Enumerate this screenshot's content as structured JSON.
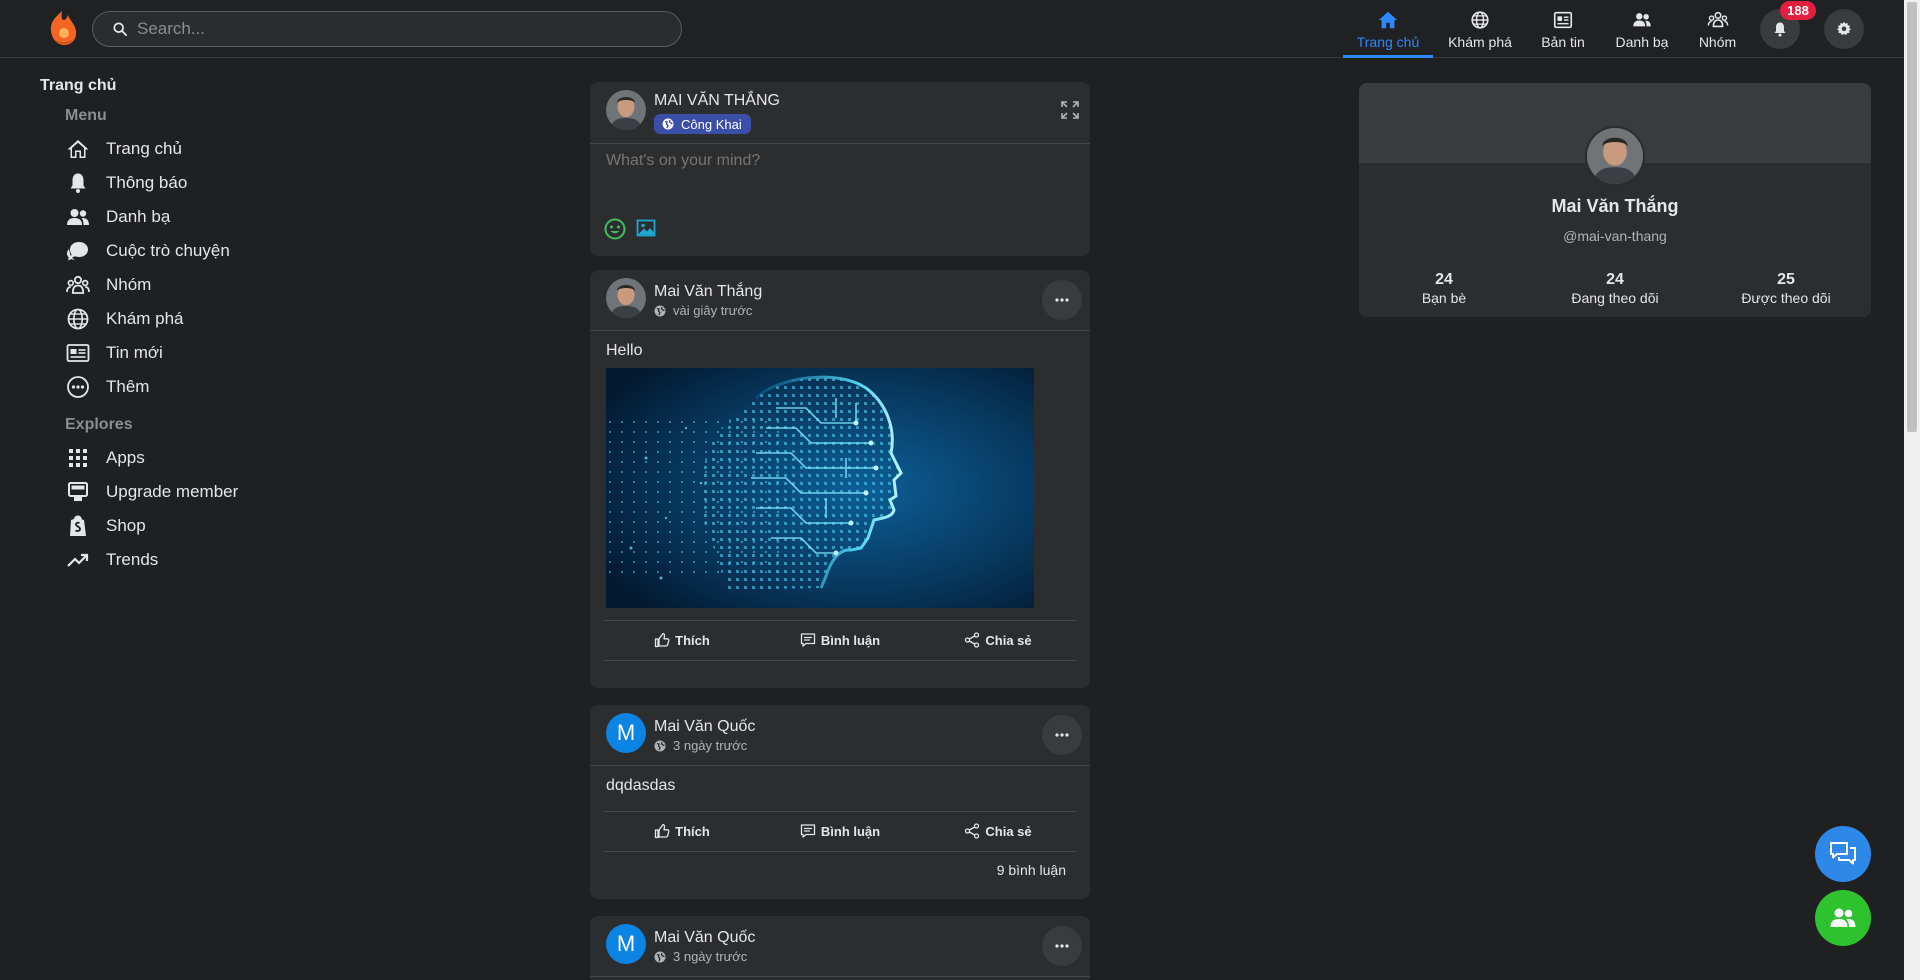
{
  "header": {
    "search_placeholder": "Search...",
    "nav": [
      {
        "label": "Trang chủ",
        "icon": "home-icon",
        "active": true
      },
      {
        "label": "Khám phá",
        "icon": "globe-icon"
      },
      {
        "label": "Bản tin",
        "icon": "newspaper-icon"
      },
      {
        "label": "Danh bạ",
        "icon": "contacts-icon"
      },
      {
        "label": "Nhóm",
        "icon": "group-icon"
      }
    ],
    "notification_count": "188",
    "colors": {
      "accent": "#2d88ff",
      "badge": "#e41e3f",
      "brand": "#f26522"
    }
  },
  "sidebar": {
    "title": "Trang chủ",
    "menu_heading": "Menu",
    "menu": [
      {
        "label": "Trang chủ",
        "icon": "home-icon"
      },
      {
        "label": "Thông báo",
        "icon": "bell-icon"
      },
      {
        "label": "Danh bạ",
        "icon": "contacts-icon"
      },
      {
        "label": "Cuộc trò chuyện",
        "icon": "chat-icon"
      },
      {
        "label": "Nhóm",
        "icon": "group-icon"
      },
      {
        "label": "Khám phá",
        "icon": "globe-icon"
      },
      {
        "label": "Tin mới",
        "icon": "newspaper-icon"
      },
      {
        "label": "Thêm",
        "icon": "more-circle-icon"
      }
    ],
    "explores_heading": "Explores",
    "explores": [
      {
        "label": "Apps",
        "icon": "apps-grid-icon"
      },
      {
        "label": "Upgrade member",
        "icon": "upgrade-icon"
      },
      {
        "label": "Shop",
        "icon": "shop-icon"
      },
      {
        "label": "Trends",
        "icon": "trend-icon"
      }
    ]
  },
  "composer": {
    "user_name": "MAI VĂN THẮNG",
    "privacy": "Công Khai",
    "placeholder": "What's on your mind?"
  },
  "posts": [
    {
      "author": "Mai Văn Thắng",
      "time": "vài giây trước",
      "text": "Hello",
      "has_image": true,
      "image": "ai-circuit-head"
    },
    {
      "author": "Mai Văn Quốc",
      "avatar_letter": "M",
      "time": "3 ngày trước",
      "text": "dqdasdas",
      "comments": "9 bình luận"
    },
    {
      "author": "Mai Văn Quốc",
      "avatar_letter": "M",
      "time": "3 ngày trước"
    }
  ],
  "actions": {
    "like": "Thích",
    "comment": "Bình luận",
    "share": "Chia sẻ"
  },
  "profile": {
    "name": "Mai Văn Thắng",
    "handle": "@mai-van-thang",
    "stats": [
      {
        "value": "24",
        "label": "Bạn bè"
      },
      {
        "value": "24",
        "label": "Đang theo dõi"
      },
      {
        "value": "25",
        "label": "Được theo dõi"
      }
    ]
  }
}
